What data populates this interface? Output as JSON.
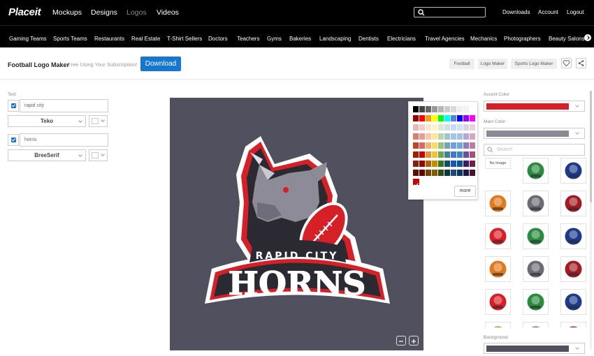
{
  "header": {
    "logo": "Placeit",
    "nav": [
      "Mockups",
      "Designs",
      "Logos",
      "Videos"
    ],
    "links": [
      "Downloads",
      "Account",
      "Logout"
    ]
  },
  "categories": [
    "Gaming Teams",
    "Sports Teams",
    "Restaurants",
    "Real Estate",
    "T-Shirt Sellers",
    "Doctors",
    "Teachers",
    "Gyms",
    "Bakeries",
    "Landscaping",
    "Dentists",
    "Electricians",
    "Travel Agencies",
    "Mechanics",
    "Photographers",
    "Beauty Salons"
  ],
  "titlebar": {
    "title": "Football Logo Maker",
    "subtitle": "Free Using Your Subscription!",
    "download": "Download",
    "tags": [
      "Football",
      "Logo Maker",
      "Sports Logo Maker"
    ],
    "heart_icon": "heart-icon",
    "share_icon": "share-icon"
  },
  "editor": {
    "text_label": "Text",
    "fields": [
      {
        "value": "rapid city",
        "font": "Teko",
        "checked": true
      },
      {
        "value": "horns",
        "font": "BreeSerif",
        "checked": true
      }
    ]
  },
  "logo": {
    "line1": "RAPID CITY",
    "line2": "HORNS"
  },
  "palette": {
    "more": "more",
    "colors": [
      [
        "#000000",
        "#434343",
        "#666666",
        "#999999",
        "#b7b7b7",
        "#cccccc",
        "#d9d9d9",
        "#efefef",
        "#f3f3f3",
        "#ffffff"
      ],
      [
        "#980000",
        "#ff0000",
        "#ff9900",
        "#ffff00",
        "#00ff00",
        "#00ffff",
        "#4a86e8",
        "#0000ff",
        "#9900ff",
        "#ff00ff"
      ],
      [
        "#e6b8af",
        "#f4cccc",
        "#fce5cd",
        "#fff2cc",
        "#d9ead3",
        "#d0e0e3",
        "#c9daf8",
        "#cfe2f3",
        "#d9d2e9",
        "#ead1dc"
      ],
      [
        "#dd7e6b",
        "#ea9999",
        "#f9cb9c",
        "#ffe599",
        "#b6d7a8",
        "#a2c4c9",
        "#a4c2f4",
        "#9fc5e8",
        "#b4a7d6",
        "#d5a6bd"
      ],
      [
        "#cc4125",
        "#e06666",
        "#f6b26b",
        "#ffd966",
        "#93c47d",
        "#76a5af",
        "#6d9eeb",
        "#6fa8dc",
        "#8e7cc3",
        "#c27ba0"
      ],
      [
        "#a61c00",
        "#cc0000",
        "#e69138",
        "#f1c232",
        "#6aa84f",
        "#45818e",
        "#3c78d8",
        "#3d85c6",
        "#674ea7",
        "#a64d79"
      ],
      [
        "#85200c",
        "#990000",
        "#b45f06",
        "#bf9000",
        "#38761d",
        "#134f5c",
        "#1155cc",
        "#0b5394",
        "#351c75",
        "#741b47"
      ],
      [
        "#5b0f00",
        "#660000",
        "#783f04",
        "#7f6000",
        "#274e13",
        "#0c343d",
        "#1c4587",
        "#073763",
        "#20124d",
        "#4c1130"
      ]
    ],
    "selected": "#cc0000"
  },
  "right_panel": {
    "accent_label": "Accent Color",
    "accent_color": "#d61f26",
    "main_label": "Main Color",
    "main_color": "#8a8a94",
    "search_placeholder": "Search",
    "no_image": "No Image",
    "background_label": "Background",
    "background_color": "#51505f",
    "thumbnails": [
      "no-image",
      "rhino-mascot-icon",
      "football-player-icon",
      "football-player-icon",
      "football-player-icon",
      "helmet-icon",
      "jersey-icon",
      "mascot-face-icon",
      "mascot-face-icon",
      "helmet-icon",
      "football-icon",
      "football-icon",
      "mascot-icon",
      "player-icon",
      "helmet-icon",
      "helmet-icon",
      "player-icon",
      "helmet-icon"
    ]
  }
}
